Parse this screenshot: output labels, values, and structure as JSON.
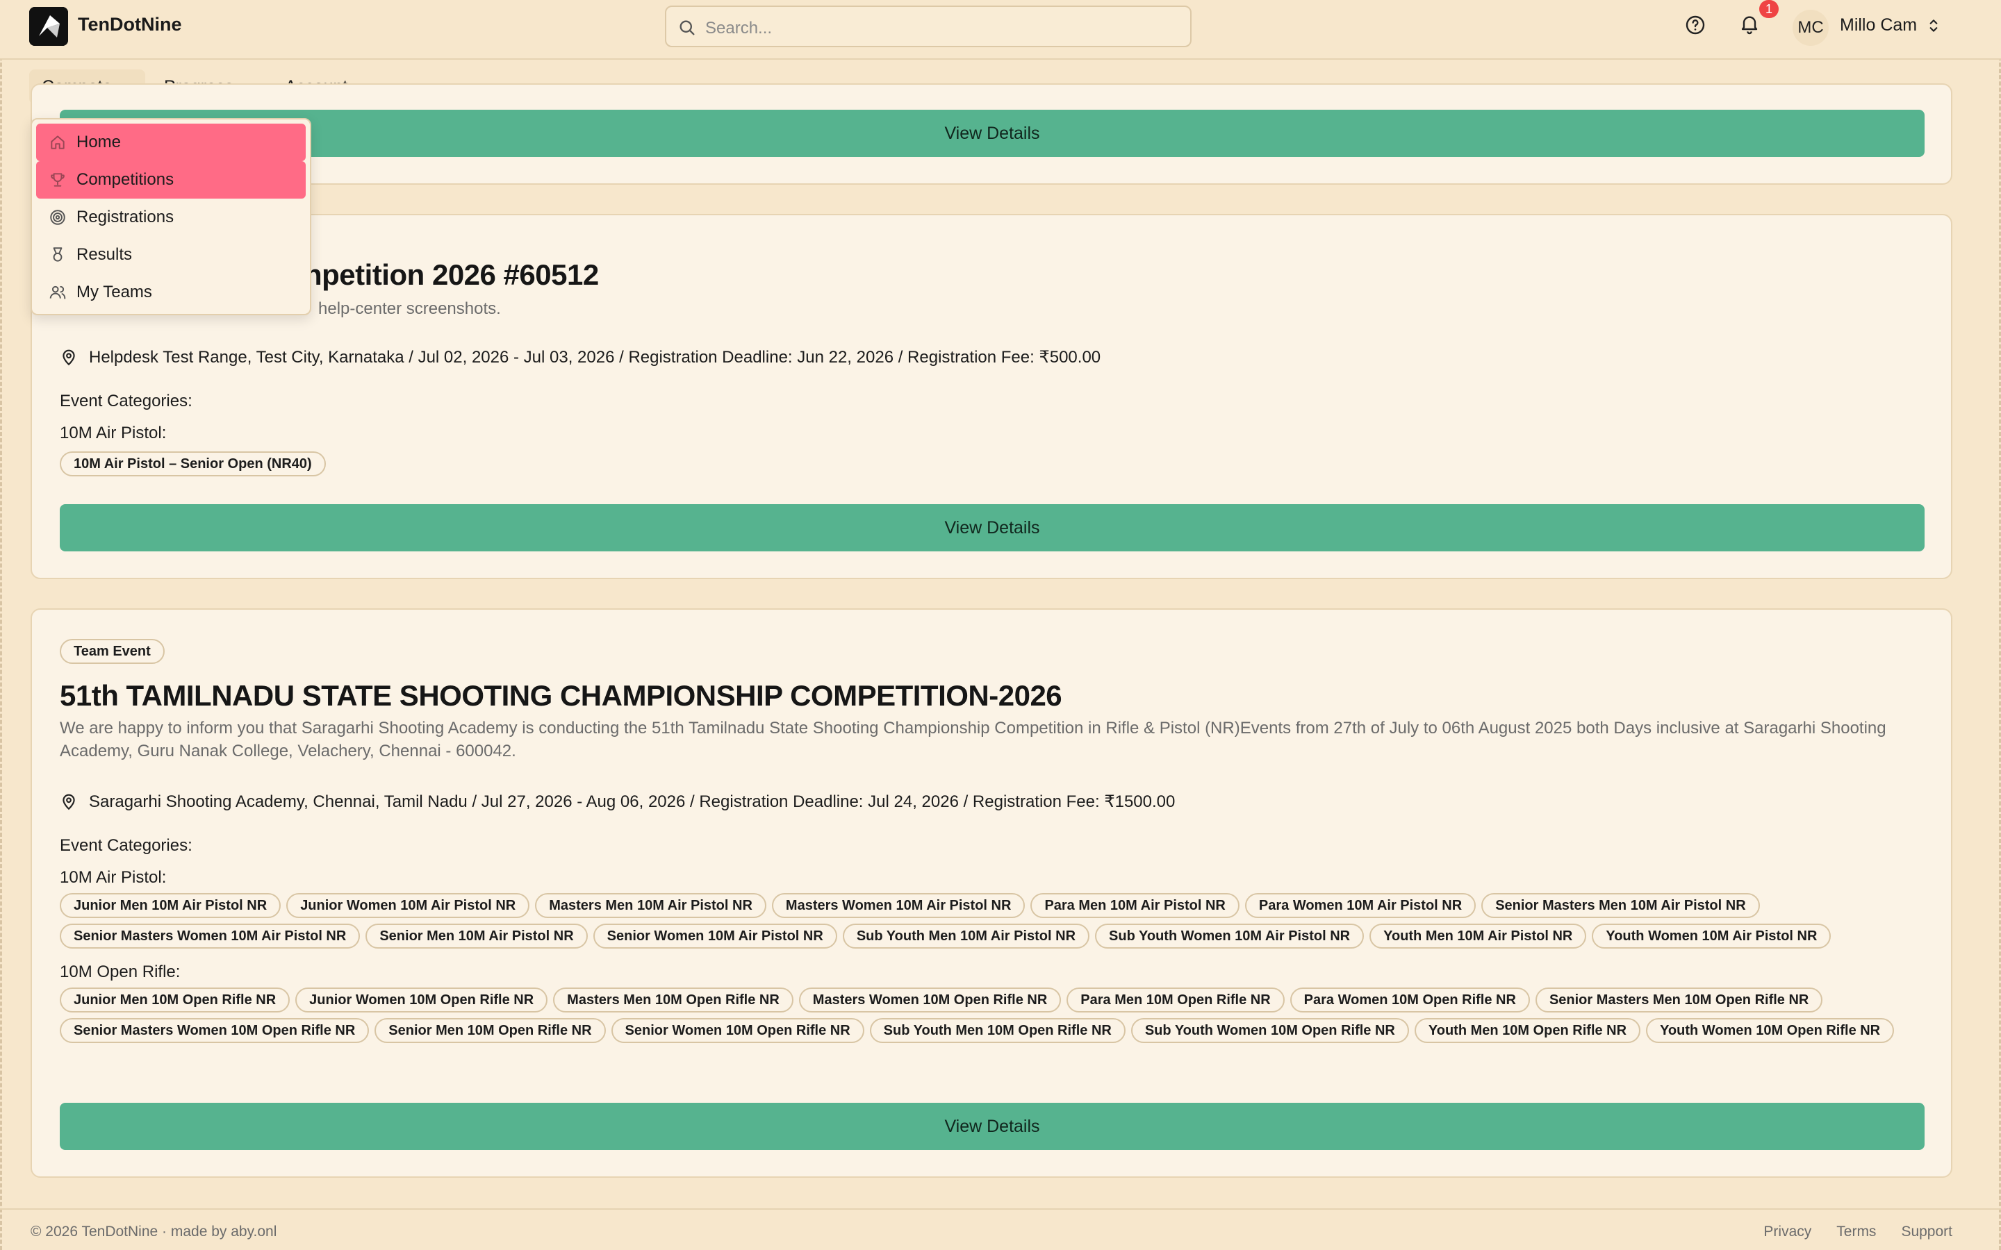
{
  "app": {
    "name": "TenDotNine"
  },
  "search": {
    "placeholder": "Search..."
  },
  "header": {
    "notification_count": "1",
    "user_initials": "MC",
    "user_name": "Millo Cam"
  },
  "nav": {
    "items": [
      {
        "label": "Compete",
        "active": true
      },
      {
        "label": "Progress"
      },
      {
        "label": "Account"
      }
    ]
  },
  "dropdown": {
    "items": [
      {
        "label": "Home",
        "icon": "home-icon",
        "highlighted": true
      },
      {
        "label": "Competitions",
        "icon": "trophy-icon",
        "highlighted": true
      },
      {
        "label": "Registrations",
        "icon": "target-icon"
      },
      {
        "label": "Results",
        "icon": "medal-icon"
      },
      {
        "label": "My Teams",
        "icon": "users-icon"
      }
    ]
  },
  "cards": [
    {
      "button": "View Details"
    },
    {
      "title_visible": "npetition 2026 #60512",
      "desc_visible": "help-center screenshots.",
      "meta": "Helpdesk Test Range, Test City, Karnataka / Jul 02, 2026 - Jul 03, 2026 / Registration Deadline: Jun 22, 2026 / Registration Fee: ₹500.00",
      "categories_label": "Event Categories:",
      "groups": [
        {
          "label": "10M Air Pistol:",
          "chips": [
            "10M Air Pistol – Senior Open (NR40)"
          ]
        }
      ],
      "button": "View Details"
    },
    {
      "tag": "Team Event",
      "title": "51th TAMILNADU STATE SHOOTING CHAMPIONSHIP COMPETITION-2026",
      "desc": "We are happy to inform you that Saragarhi Shooting Academy is conducting the 51th Tamilnadu State Shooting Championship Competition in Rifle & Pistol (NR)Events from 27th of July to 06th August 2025 both Days inclusive at Saragarhi Shooting Academy, Guru Nanak College, Velachery, Chennai - 600042.",
      "meta": "Saragarhi Shooting Academy, Chennai, Tamil Nadu / Jul 27, 2026 - Aug 06, 2026 / Registration Deadline: Jul 24, 2026 / Registration Fee: ₹1500.00",
      "categories_label": "Event Categories:",
      "groups": [
        {
          "label": "10M Air Pistol:",
          "chips": [
            "Junior Men 10M Air Pistol NR",
            "Junior Women 10M Air Pistol NR",
            "Masters Men 10M Air Pistol NR",
            "Masters Women 10M Air Pistol NR",
            "Para Men 10M Air Pistol NR",
            "Para Women 10M Air Pistol NR",
            "Senior Masters Men 10M Air Pistol NR",
            "Senior Masters Women 10M Air Pistol NR",
            "Senior Men 10M Air Pistol NR",
            "Senior Women 10M Air Pistol NR",
            "Sub Youth Men 10M Air Pistol NR",
            "Sub Youth Women 10M Air Pistol NR",
            "Youth Men 10M Air Pistol NR",
            "Youth Women 10M Air Pistol NR"
          ]
        },
        {
          "label": "10M Open Rifle:",
          "chips": [
            "Junior Men 10M Open Rifle NR",
            "Junior Women 10M Open Rifle NR",
            "Masters Men 10M Open Rifle NR",
            "Masters Women 10M Open Rifle NR",
            "Para Men 10M Open Rifle NR",
            "Para Women 10M Open Rifle NR",
            "Senior Masters Men 10M Open Rifle NR",
            "Senior Masters Women 10M Open Rifle NR",
            "Senior Men 10M Open Rifle NR",
            "Senior Women 10M Open Rifle NR",
            "Sub Youth Men 10M Open Rifle NR",
            "Sub Youth Women 10M Open Rifle NR",
            "Youth Men 10M Open Rifle NR",
            "Youth Women 10M Open Rifle NR"
          ]
        }
      ],
      "button": "View Details"
    }
  ],
  "footer": {
    "copyright": "© 2026 TenDotNine · made by aby.onl",
    "links": [
      "Privacy",
      "Terms",
      "Support"
    ]
  },
  "colors": {
    "background": "#f7e7cc",
    "accent_green": "#56b38f",
    "highlight_pink": "#ff6b86",
    "badge_red": "#ef4444"
  }
}
